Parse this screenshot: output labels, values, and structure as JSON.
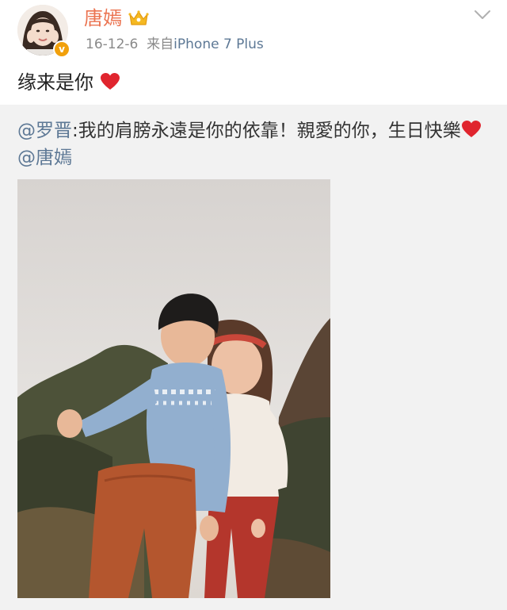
{
  "author": {
    "name": "唐嫣",
    "date": "16-12-6",
    "source_prefix": "来自",
    "source_device": "iPhone 7 Plus",
    "verified_mark": "v"
  },
  "post": {
    "text": "缘来是你"
  },
  "repost": {
    "mention": "@罗晋",
    "text_part1": ":我的肩膀永遠是你的依靠！親愛的你，生日快樂",
    "mention_end": "@唐嫣"
  },
  "colors": {
    "username": "#eb7350",
    "link": "#5d7895",
    "heart": "#e0252e",
    "badge": "#f1a00c",
    "repost_bg": "#f2f2f2"
  },
  "icons": {
    "crown": "crown-icon",
    "heart": "heart-icon",
    "chevron": "chevron-down-icon",
    "badge": "verified-badge"
  }
}
